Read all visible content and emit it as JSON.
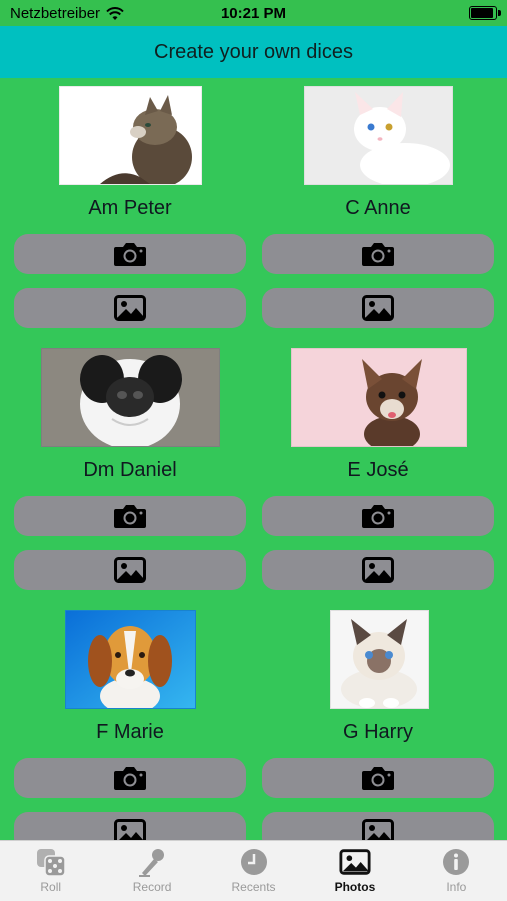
{
  "status": {
    "carrier": "Netzbetreiber",
    "time": "10:21 PM"
  },
  "header": {
    "title": "Create your own dices"
  },
  "dice": [
    {
      "name": "Am Peter",
      "photo_bg": "#ffffff",
      "animal": "cat-tabby"
    },
    {
      "name": "C Anne",
      "photo_bg": "#f2f2f2",
      "animal": "cat-white"
    },
    {
      "name": "Dm Daniel",
      "photo_bg": "#8a8a8a",
      "animal": "dog-closeup"
    },
    {
      "name": "E José",
      "photo_bg": "#f6d6dc",
      "animal": "dog-chihuahua"
    },
    {
      "name": "F Marie",
      "photo_bg": "#1c8fe0",
      "animal": "dog-beagle"
    },
    {
      "name": "G Harry",
      "photo_bg": "#f4f4f4",
      "animal": "cat-ragdoll"
    }
  ],
  "tabs": [
    {
      "label": "Roll",
      "icon": "dice-icon",
      "active": false
    },
    {
      "label": "Record",
      "icon": "microphone-icon",
      "active": false
    },
    {
      "label": "Recents",
      "icon": "clock-icon",
      "active": false
    },
    {
      "label": "Photos",
      "icon": "photo-icon",
      "active": true
    },
    {
      "label": "Info",
      "icon": "info-icon",
      "active": false
    }
  ],
  "colors": {
    "background": "#34c759",
    "header": "#00c0c0",
    "button": "#8e8e93"
  }
}
